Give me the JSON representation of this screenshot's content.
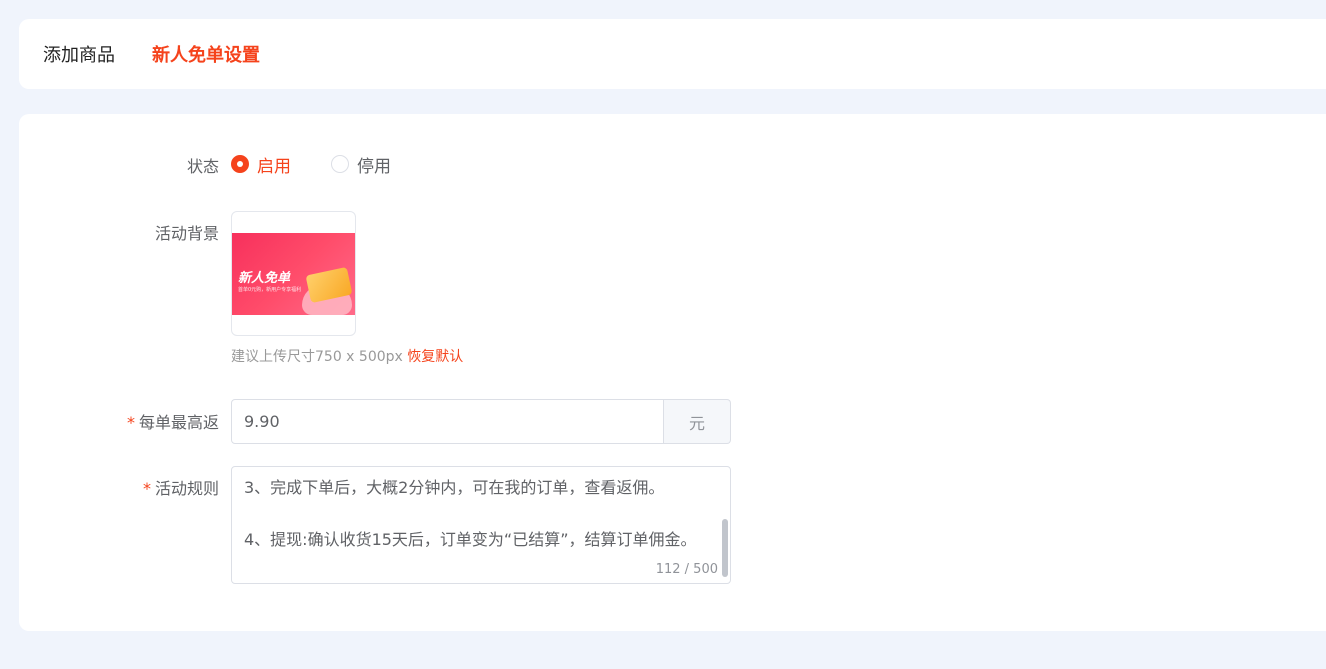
{
  "tabs": [
    {
      "label": "添加商品",
      "active": false
    },
    {
      "label": "新人免单设置",
      "active": true
    }
  ],
  "form": {
    "status": {
      "label": "状态",
      "options": [
        {
          "label": "启用",
          "checked": true
        },
        {
          "label": "停用",
          "checked": false
        }
      ]
    },
    "background": {
      "label": "活动背景",
      "banner_title": "新人免单",
      "banner_sub": "首单0元购，新用户专享福利",
      "hint_text": "建议上传尺寸750 x 500px",
      "reset_link": "恢复默认"
    },
    "max_rebate": {
      "required_mark": "*",
      "label": "每单最高返",
      "value": "9.90",
      "unit": "元"
    },
    "rules": {
      "required_mark": "*",
      "label": "活动规则",
      "text": "3、完成下单后，大概2分钟内，可在我的订单，查看返佣。\n\n4、提现:确认收货15天后，订单变为“已结算”，结算订单佣金。",
      "count": "112 / 500"
    }
  },
  "colors": {
    "accent": "#f5431c",
    "page_bg": "#f0f4fc",
    "card_bg": "#ffffff"
  }
}
